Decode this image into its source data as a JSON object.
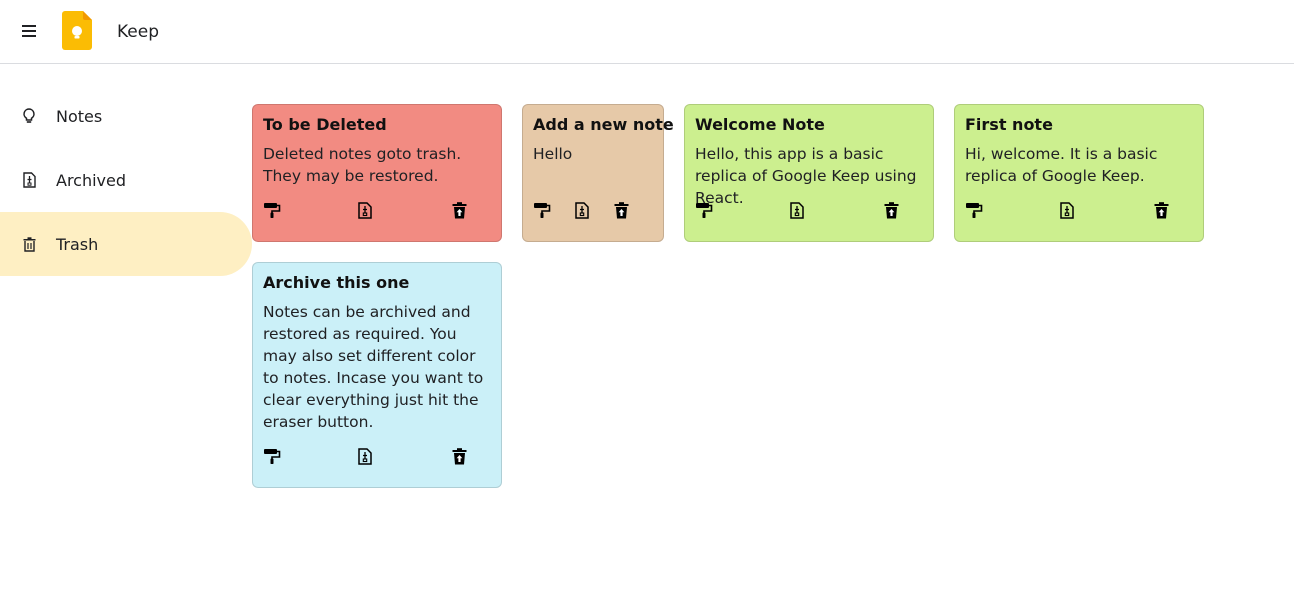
{
  "app": {
    "title": "Keep"
  },
  "colors": {
    "active_nav": "#feefc3",
    "logo": "#fbbc04"
  },
  "sidebar": {
    "items": [
      {
        "label": "Notes",
        "icon": "lightbulb-icon",
        "active": false
      },
      {
        "label": "Archived",
        "icon": "archive-icon",
        "active": false
      },
      {
        "label": "Trash",
        "icon": "trash-icon",
        "active": true
      }
    ]
  },
  "notes": [
    {
      "title": "To be Deleted",
      "body": "Deleted notes goto trash. They may be restored.",
      "color": "#f28b82",
      "actions": [
        "palette-icon",
        "archive-icon",
        "restore-from-trash-icon"
      ]
    },
    {
      "title": "Add a new note",
      "body": "Hello",
      "color": "#e6c9a8",
      "actions": [
        "palette-icon",
        "archive-icon",
        "restore-from-trash-icon"
      ]
    },
    {
      "title": "Welcome Note",
      "body": "Hello, this app is a basic replica of Google Keep using React.",
      "color": "#ccef8f",
      "actions": [
        "palette-icon",
        "archive-icon",
        "restore-from-trash-icon"
      ]
    },
    {
      "title": "First note",
      "body": "Hi, welcome. It is a basic replica of Google Keep.",
      "color": "#ccef8f",
      "actions": [
        "palette-icon",
        "archive-icon",
        "restore-from-trash-icon"
      ]
    },
    {
      "title": "Archive this one",
      "body": "Notes can be archived and restored as required. You may also set different color to notes. Incase you want to clear everything just hit the eraser button.",
      "color": "#cbf0f8",
      "actions": [
        "palette-icon",
        "archive-icon",
        "restore-from-trash-icon"
      ]
    }
  ]
}
